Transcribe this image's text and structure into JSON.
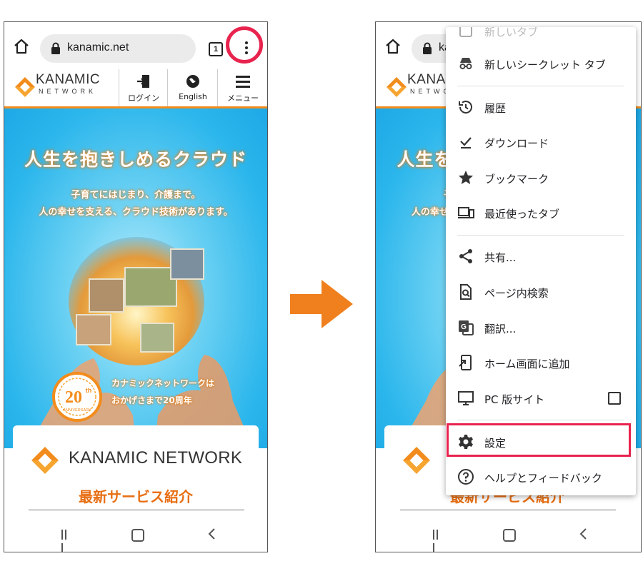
{
  "browser": {
    "url": "kanamic.net",
    "url_truncated": "ka",
    "tab_count": "1"
  },
  "site": {
    "logo_title": "KANAMIC",
    "logo_subtitle": "NETWORK",
    "nav": [
      {
        "label": "ログイン",
        "icon": "login-door-icon"
      },
      {
        "label": "English",
        "icon": "globe-icon"
      },
      {
        "label": "メニュー",
        "icon": "hamburger-icon"
      }
    ]
  },
  "hero": {
    "title": "人生を抱きしめるクラウド",
    "subtitle_line1": "子育てにはじまり、介護まで。",
    "subtitle_line2": "人の幸せを支える、クラウド技術があります。",
    "anniversary_line1": "カナミックネットワークは",
    "anniversary_line2": "おかげさまで20周年",
    "badge_number": "20",
    "badge_suffix": "th",
    "badge_caption": "ANNIVERSARY"
  },
  "card": {
    "brand": "KANAMIC NETWORK",
    "heading": "最新サービス紹介"
  },
  "menu": {
    "items": [
      {
        "label": "新しいタブ",
        "icon": "new-tab-icon"
      },
      {
        "label": "新しいシークレット タブ",
        "icon": "incognito-icon"
      },
      {
        "label": "履歴",
        "icon": "history-icon"
      },
      {
        "label": "ダウンロード",
        "icon": "download-icon"
      },
      {
        "label": "ブックマーク",
        "icon": "star-icon"
      },
      {
        "label": "最近使ったタブ",
        "icon": "recent-tabs-icon"
      },
      {
        "label": "共有...",
        "icon": "share-icon"
      },
      {
        "label": "ページ内検索",
        "icon": "find-in-page-icon"
      },
      {
        "label": "翻訳...",
        "icon": "translate-icon"
      },
      {
        "label": "ホーム画面に追加",
        "icon": "add-to-home-icon"
      },
      {
        "label": "PC 版サイト",
        "icon": "desktop-icon",
        "checked": false
      },
      {
        "label": "設定",
        "icon": "gear-icon"
      },
      {
        "label": "ヘルプとフィードバック",
        "icon": "help-icon"
      }
    ]
  },
  "colors": {
    "highlight": "#e8234e",
    "brand_orange": "#f28c1c",
    "arrow": "#f0801e"
  }
}
